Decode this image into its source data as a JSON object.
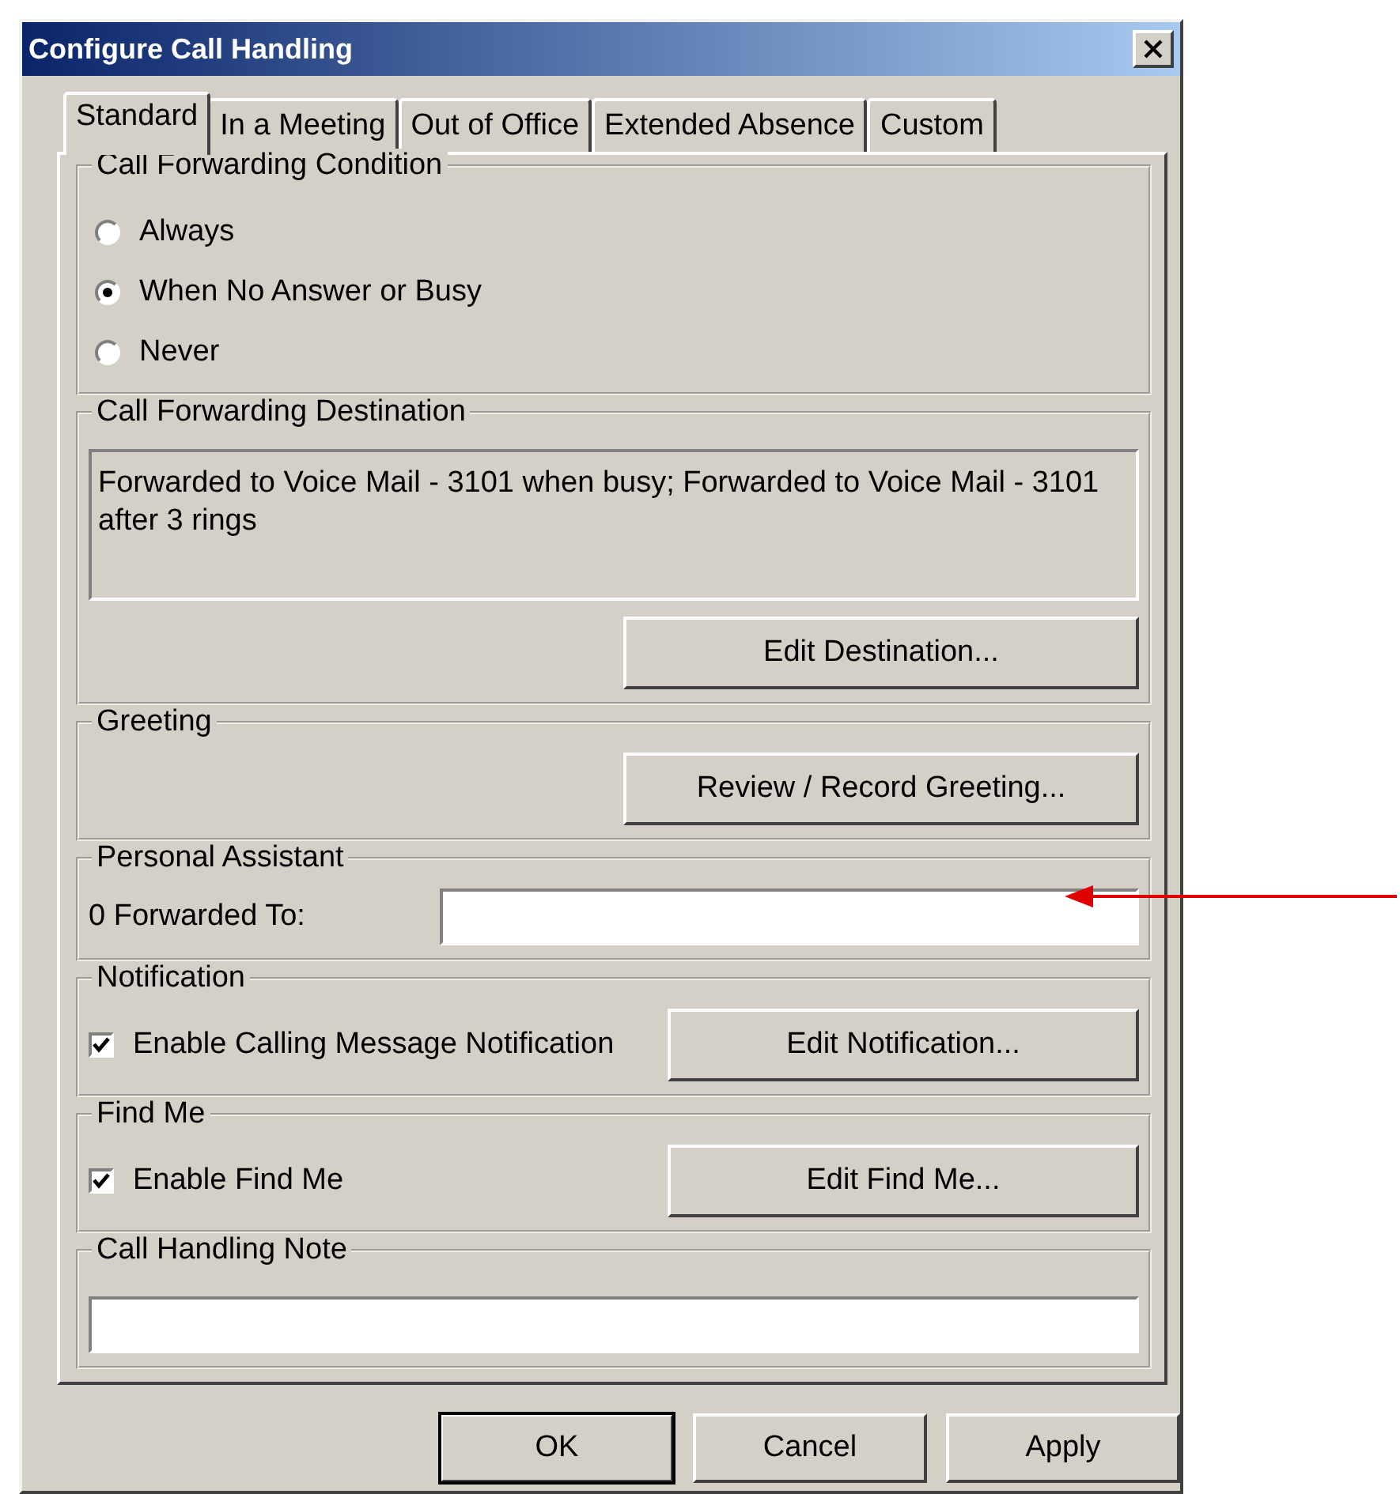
{
  "window": {
    "title": "Configure Call Handling"
  },
  "tabs": [
    {
      "label": "Standard",
      "selected": true
    },
    {
      "label": "In a Meeting",
      "selected": false
    },
    {
      "label": "Out of Office",
      "selected": false
    },
    {
      "label": "Extended Absence",
      "selected": false
    },
    {
      "label": "Custom",
      "selected": false
    }
  ],
  "groups": [
    {
      "kind": "radios",
      "legend": "Call Forwarding Condition",
      "options": [
        {
          "label": "Always",
          "selected": false
        },
        {
          "label": "When No Answer or Busy",
          "selected": true
        },
        {
          "label": "Never",
          "selected": false
        }
      ]
    },
    {
      "kind": "destination",
      "legend": "Call Forwarding Destination",
      "text": "Forwarded to Voice Mail - 3101 when busy; Forwarded to Voice Mail - 3101 after 3 rings",
      "button": "Edit Destination..."
    },
    {
      "kind": "button",
      "legend": "Greeting",
      "button": "Review / Record Greeting..."
    },
    {
      "kind": "field",
      "legend": "Personal Assistant",
      "label": "0 Forwarded To:"
    },
    {
      "kind": "checkbox",
      "legend": "Notification",
      "checkbox": {
        "label": "Enable Calling Message Notification",
        "checked": true
      },
      "button": "Edit Notification..."
    },
    {
      "kind": "checkbox",
      "legend": "Find Me",
      "checkbox": {
        "label": "Enable Find Me",
        "checked": true
      },
      "button": "Edit Find Me..."
    },
    {
      "kind": "note",
      "legend": "Call Handling Note"
    }
  ],
  "buttons": [
    {
      "label": "OK",
      "default": true
    },
    {
      "label": "Cancel",
      "default": false
    },
    {
      "label": "Apply",
      "default": false
    }
  ]
}
